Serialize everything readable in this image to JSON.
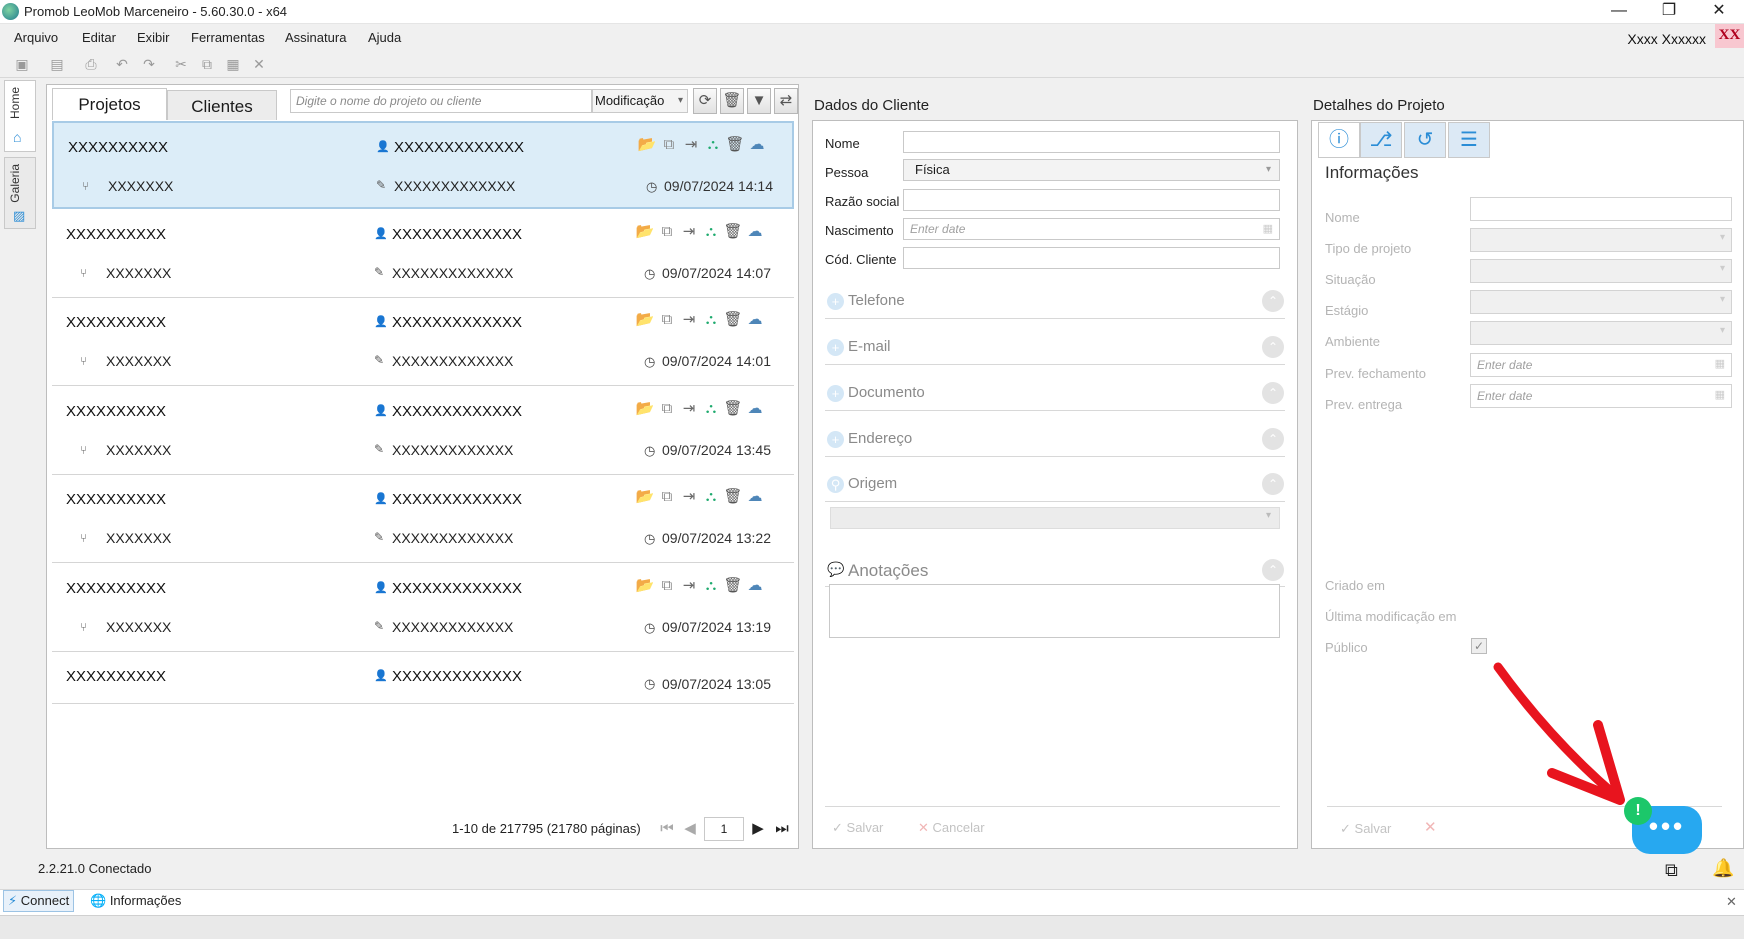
{
  "window": {
    "title": "Promob LeoMob Marceneiro - 5.60.30.0 - x64",
    "minimize_glyph": "—",
    "maximize_glyph": "❐",
    "close_glyph": "✕"
  },
  "menu": [
    "Arquivo",
    "Editar",
    "Exibir",
    "Ferramentas",
    "Assinatura",
    "Ajuda"
  ],
  "user": {
    "name": "Xxxx Xxxxxx",
    "initials": "XX"
  },
  "side_tabs": [
    "Home",
    "Galeria"
  ],
  "projects": {
    "tabs": [
      "Projetos",
      "Clientes"
    ],
    "search_placeholder": "Digite o nome do projeto ou cliente",
    "sort_value": "Modificação",
    "rows": [
      {
        "name": "XXXXXXXXXX",
        "client": "XXXXXXXXXXXXX",
        "env": "XXXXXXX",
        "designer": "XXXXXXXXXXXXX",
        "modified": "09/07/2024 14:14"
      },
      {
        "name": "XXXXXXXXXX",
        "client": "XXXXXXXXXXXXX",
        "env": "XXXXXXX",
        "designer": "XXXXXXXXXXXXX",
        "modified": "09/07/2024 14:07"
      },
      {
        "name": "XXXXXXXXXX",
        "client": "XXXXXXXXXXXXX",
        "env": "XXXXXXX",
        "designer": "XXXXXXXXXXXXX",
        "modified": "09/07/2024 14:01"
      },
      {
        "name": "XXXXXXXXXX",
        "client": "XXXXXXXXXXXXX",
        "env": "XXXXXXX",
        "designer": "XXXXXXXXXXXXX",
        "modified": "09/07/2024 13:45"
      },
      {
        "name": "XXXXXXXXXX",
        "client": "XXXXXXXXXXXXX",
        "env": "XXXXXXX",
        "designer": "XXXXXXXXXXXXX",
        "modified": "09/07/2024 13:22"
      },
      {
        "name": "XXXXXXXXXX",
        "client": "XXXXXXXXXXXXX",
        "env": "XXXXXXX",
        "designer": "XXXXXXXXXXXXX",
        "modified": "09/07/2024 13:19"
      },
      {
        "name": "XXXXXXXXXX",
        "client": "XXXXXXXXXXXXX",
        "env": "",
        "designer": "",
        "modified": "09/07/2024 13:05"
      }
    ],
    "pager": {
      "text": "1-10 de 217795 (21780 páginas)",
      "page": "1"
    }
  },
  "client": {
    "header": "Dados do Cliente",
    "fields": {
      "nome_label": "Nome",
      "pessoa_label": "Pessoa",
      "pessoa_value": "Física",
      "razao_label": "Razão social",
      "nascimento_label": "Nascimento",
      "nascimento_placeholder": "Enter date",
      "cod_label": "Cód. Cliente"
    },
    "sections": [
      "Telefone",
      "E-mail",
      "Documento",
      "Endereço",
      "Origem"
    ],
    "anotacoes": "Anotações",
    "save": "Salvar",
    "cancel": "Cancelar"
  },
  "details": {
    "header": "Detalhes do Projeto",
    "section_title": "Informações",
    "labels": [
      "Nome",
      "Tipo de projeto",
      "Situação",
      "Estágio",
      "Ambiente",
      "Prev. fechamento",
      "Prev. entrega"
    ],
    "date_placeholder": "Enter date",
    "criado": "Criado em",
    "ultima": "Última modificação em",
    "publico": "Público",
    "save": "Salvar"
  },
  "status": {
    "text": "2.2.21.0 Conectado"
  },
  "bottom_tabs": [
    "Connect",
    "Informações"
  ],
  "colors": {
    "selection": "#dcedf8",
    "accent": "#27a8f0",
    "annotation_arrow": "#e8141e",
    "badge": "#1cc76a"
  }
}
